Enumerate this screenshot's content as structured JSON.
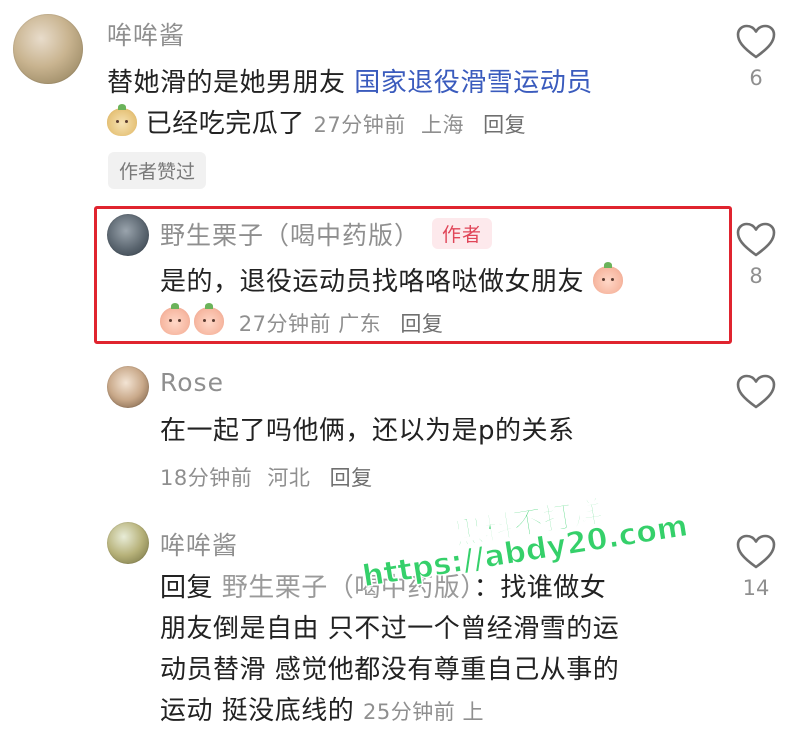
{
  "comments": [
    {
      "user": "哞哞酱",
      "text_plain": "替她滑的是她男朋友 ",
      "text_link": "国家退役滑雪运动员",
      "text_line2": "已经吃完瓜了",
      "time": "27分钟前",
      "location": "上海",
      "reply": "回复",
      "chip": "作者赞过",
      "likes": "6"
    },
    {
      "user": "野生栗子（喝中药版）",
      "author_tag": "作者",
      "text_line1": "是的，退役运动员找咯咯哒做女朋友",
      "time": "27分钟前",
      "location": "广东",
      "reply": "回复",
      "likes": "8"
    },
    {
      "user": "Rose",
      "text_line1": "在一起了吗他俩，还以为是p的关系",
      "time": "18分钟前",
      "location": "河北",
      "reply": "回复",
      "likes": ""
    },
    {
      "user": "哞哞酱",
      "reply_prefix": "回复 ",
      "reply_to": "野生栗子（喝中药版）",
      "line1_tail": "：找谁做女",
      "line2": "朋友倒是自由 只不过一个曾经滑雪的运",
      "line3": "动员替滑 感觉他都没有尊重自己从事的",
      "line4": "运动 挺没底线的",
      "time": "25分钟前",
      "location": "上",
      "likes": "14"
    }
  ],
  "watermark": {
    "line1": "黑料不打烊",
    "line2": "https://abdy20.com",
    "color": "#35d06a"
  },
  "colors": {
    "highlight_border": "#e0242f",
    "link": "#3a5bbd",
    "author_tag": "#e04558"
  }
}
